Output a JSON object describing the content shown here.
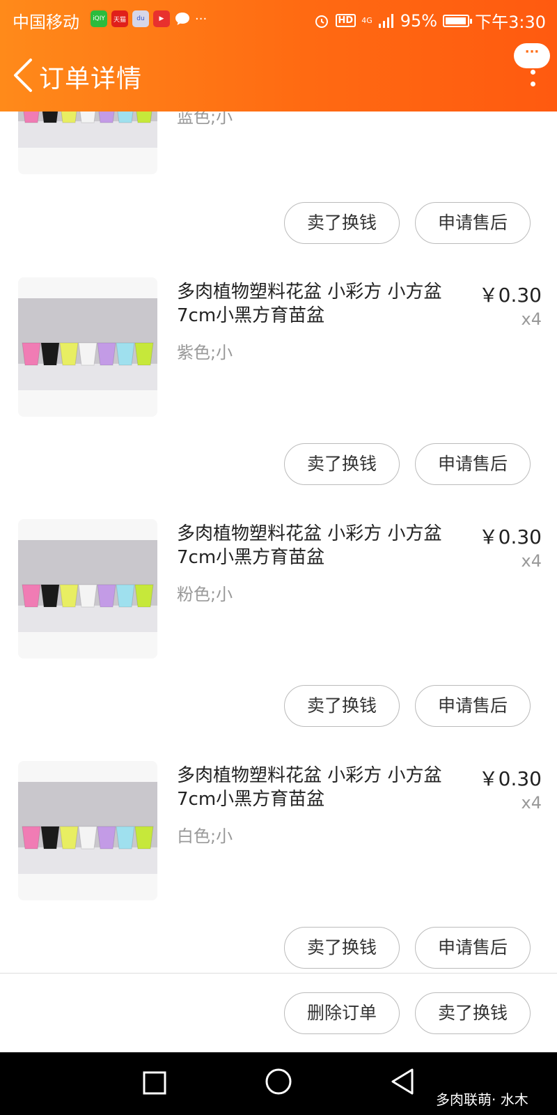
{
  "status_bar": {
    "carrier": "中国移动",
    "app_icons": [
      {
        "name": "iqiyi-icon",
        "label": "iQIY",
        "color": "#2bbc3d"
      },
      {
        "name": "tmall-icon",
        "label": "天猫",
        "color": "#e0201a"
      },
      {
        "name": "baidu-icon",
        "label": "du",
        "color": "#d6d6e8"
      },
      {
        "name": "video-icon",
        "label": "▶",
        "color": "#e8312e"
      },
      {
        "name": "message-icon",
        "label": "",
        "color": "#ffffff"
      }
    ],
    "overflow": "···",
    "network": "4G",
    "battery": "95%",
    "battery_level": 0.95,
    "time": "下午3:30"
  },
  "header": {
    "title": "订单详情",
    "more_label": "···"
  },
  "items": [
    {
      "name": "",
      "spec": "蓝色;小",
      "price": "",
      "qty": "",
      "btn_sell": "卖了换钱",
      "btn_service": "申请售后"
    },
    {
      "name": "多肉植物塑料花盆 小彩方 小方盆7cm小黑方育苗盆",
      "spec": "紫色;小",
      "price": "￥0.30",
      "qty": "x4",
      "btn_sell": "卖了换钱",
      "btn_service": "申请售后"
    },
    {
      "name": "多肉植物塑料花盆 小彩方 小方盆7cm小黑方育苗盆",
      "spec": "粉色;小",
      "price": "￥0.30",
      "qty": "x4",
      "btn_sell": "卖了换钱",
      "btn_service": "申请售后"
    },
    {
      "name": "多肉植物塑料花盆 小彩方 小方盆7cm小黑方育苗盆",
      "spec": "白色;小",
      "price": "￥0.30",
      "qty": "x4",
      "btn_sell": "卖了换钱",
      "btn_service": "申请售后"
    }
  ],
  "footer": {
    "delete_label": "删除订单",
    "sell_label": "卖了换钱"
  },
  "pot_colors": [
    "#f07cb4",
    "#1a1a1a",
    "#e8ee62",
    "#f4f4f4",
    "#c39be6",
    "#9fe0ee",
    "#c6e83a"
  ],
  "watermark": "多肉联萌· 水木"
}
